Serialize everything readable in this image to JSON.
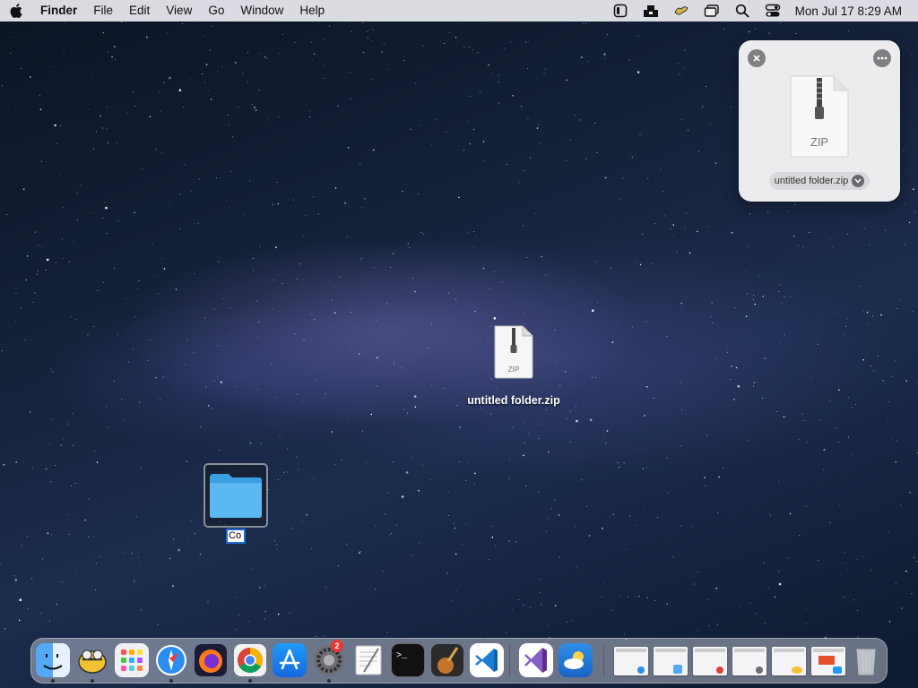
{
  "menubar": {
    "app_name": "Finder",
    "menus": [
      "File",
      "Edit",
      "View",
      "Go",
      "Window",
      "Help"
    ],
    "clock": "Mon Jul 17  8:29 AM",
    "status_icons": [
      "screen-record-icon",
      "archive-utility-icon",
      "cyberduck-icon",
      "window-manager-icon",
      "spotlight-search-icon",
      "control-center-icon"
    ]
  },
  "preview": {
    "file_type": "ZIP",
    "file_name": "untitled folder.zip"
  },
  "desktop": {
    "zip_icon_text": "ZIP",
    "zip_name": "untitled folder.zip",
    "folder_rename_text": "Co"
  },
  "dock": {
    "apps": [
      "finder",
      "cyberduck",
      "launchpad",
      "safari",
      "firefox",
      "chrome",
      "app-store",
      "system-preferences",
      "textedit",
      "terminal",
      "instruments",
      "vscode",
      "visual-studio",
      "weather"
    ],
    "system_preferences_badge": "2",
    "colors": {
      "accent": "#1f6ad8",
      "badge": "#e8382f"
    }
  }
}
